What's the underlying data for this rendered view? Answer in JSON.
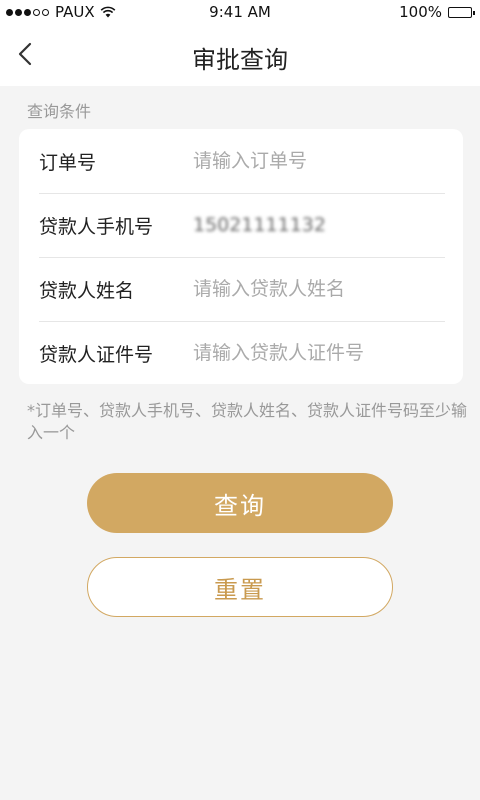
{
  "status_bar": {
    "carrier": "PAUX",
    "time": "9:41 AM",
    "battery": "100%",
    "signal_icon": "signal-dots-icon",
    "wifi_icon": "wifi-icon",
    "battery_icon": "battery-icon"
  },
  "nav": {
    "title": "审批查询",
    "back_icon": "chevron-left-icon"
  },
  "form": {
    "section_label": "查询条件",
    "fields": [
      {
        "label": "订单号",
        "value": "",
        "placeholder": "请输入订单号"
      },
      {
        "label": "贷款人手机号",
        "value": "15021111132",
        "placeholder": ""
      },
      {
        "label": "贷款人姓名",
        "value": "",
        "placeholder": "请输入贷款人姓名"
      },
      {
        "label": "贷款人证件号",
        "value": "",
        "placeholder": "请输入贷款人证件号"
      }
    ],
    "hint": "*订单号、贷款人手机号、贷款人姓名、贷款人证件号码至少输入一个"
  },
  "actions": {
    "query_label": "查询",
    "reset_label": "重置"
  },
  "colors": {
    "accent": "#d2a862",
    "background": "#f4f4f4",
    "card": "#ffffff"
  }
}
